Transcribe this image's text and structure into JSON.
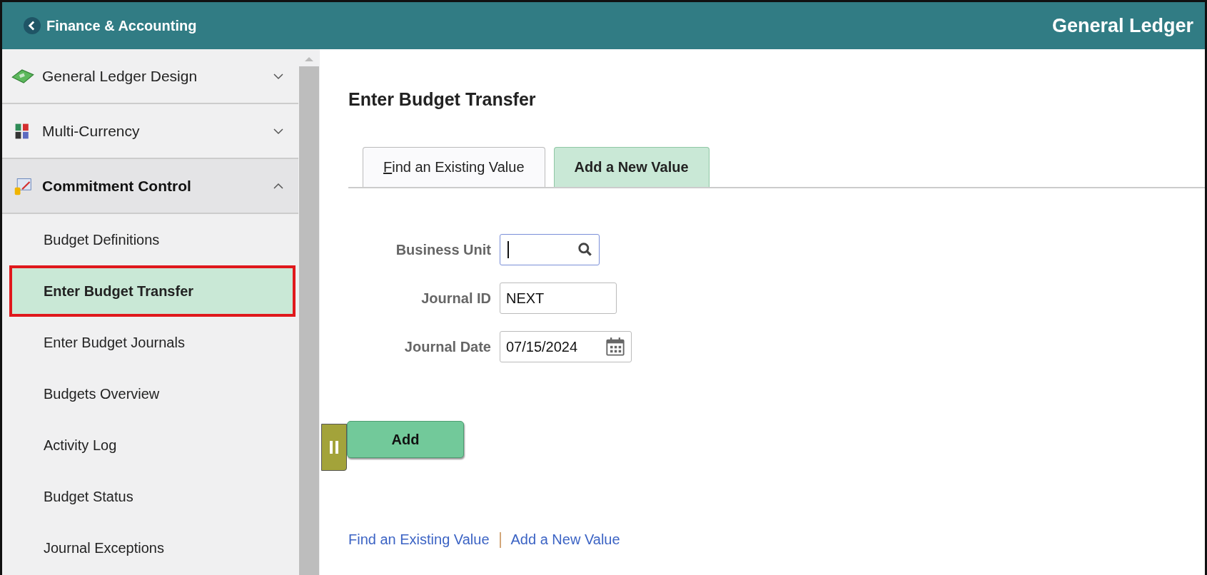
{
  "header": {
    "back_label": "Finance & Accounting",
    "title": "General Ledger"
  },
  "sidebar": {
    "items": [
      {
        "label": "General Ledger Design",
        "kind": "group",
        "expanded": false
      },
      {
        "label": "Multi-Currency",
        "kind": "group",
        "expanded": false
      },
      {
        "label": "Commitment Control",
        "kind": "group",
        "expanded": true,
        "children": [
          {
            "label": "Budget Definitions",
            "selected": false
          },
          {
            "label": "Enter Budget Transfer",
            "selected": true
          },
          {
            "label": "Enter Budget Journals",
            "selected": false
          },
          {
            "label": "Budgets Overview",
            "selected": false
          },
          {
            "label": "Activity Log",
            "selected": false
          },
          {
            "label": "Budget Status",
            "selected": false
          },
          {
            "label": "Journal Exceptions",
            "selected": false
          }
        ]
      }
    ]
  },
  "page": {
    "title": "Enter Budget Transfer",
    "tabs": [
      {
        "label": "Find an Existing Value",
        "selected": false
      },
      {
        "label": "Add a New Value",
        "selected": true
      }
    ],
    "fields": [
      {
        "label": "Business Unit",
        "kind": "lookup",
        "focused": true
      },
      {
        "label": "Journal ID",
        "kind": "text",
        "value": "NEXT",
        "focused": false
      },
      {
        "label": "Journal Date",
        "kind": "date",
        "value": "07/15/2024",
        "focused": false
      }
    ],
    "add_button": "Add",
    "links": [
      "Find an Existing Value",
      "Add a New Value"
    ]
  }
}
